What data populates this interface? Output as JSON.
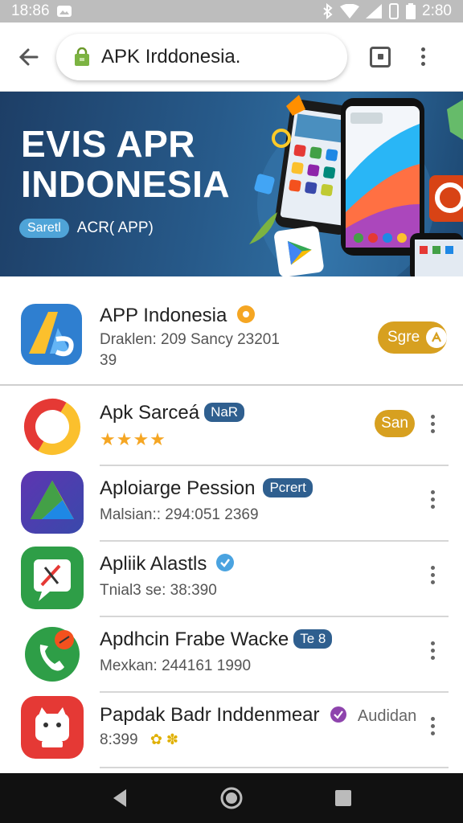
{
  "status_bar": {
    "time_left": "18:86",
    "time_right": "2:80"
  },
  "browser": {
    "url_text": "APK Irddonesia."
  },
  "banner": {
    "title_line1": "EVIS APR",
    "title_line2": "INDONESIA",
    "badge": "Saretl",
    "subtitle": "ACR( APP)"
  },
  "featured": {
    "name": "APP Indonesia",
    "sub_line1": "Draklen: 209 Sancy 23201",
    "sub_line2": "39",
    "button_label": "Sgre"
  },
  "apps": [
    {
      "name": "Apk Sarceá",
      "tag": "NaR",
      "rating_stars": 4,
      "button_label": "San"
    },
    {
      "name": "Aploiarge Pession",
      "tag": "Pcrert",
      "sub": "Malsian:: 294:051 2369"
    },
    {
      "name": "Apliik Alastls",
      "sub": "Tnial3 se: 38:390"
    },
    {
      "name": "Apdhcin Frabe Wacke",
      "tag": "Te 8",
      "sub": "Mexkan: 244161 1990"
    },
    {
      "name": "Papdak Badr Inddenmear",
      "extra": "Audidan",
      "sub": "8:399"
    }
  ],
  "colors": {
    "accent_gold": "#d7a020",
    "banner_blue": "#275a8a",
    "tag_blue": "#2f5f8f"
  }
}
